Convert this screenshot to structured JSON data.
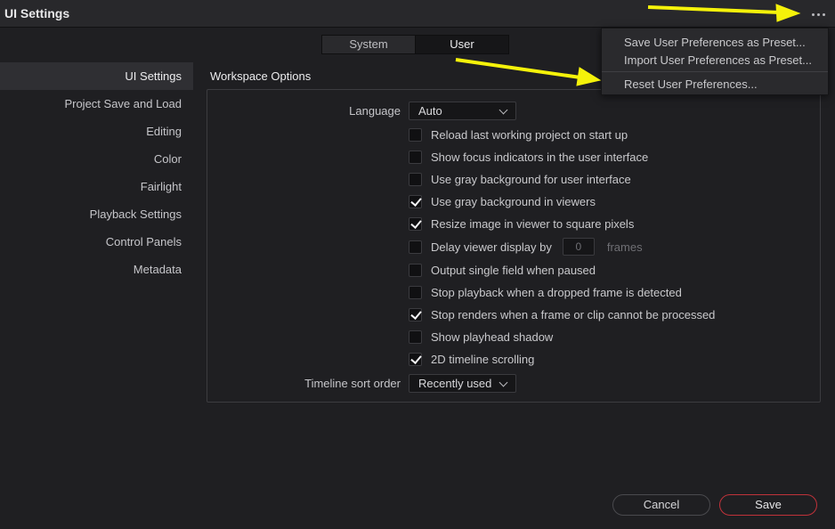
{
  "window": {
    "title": "UI Settings"
  },
  "tabs": [
    {
      "label": "System"
    },
    {
      "label": "User"
    }
  ],
  "sidebar": {
    "items": [
      {
        "label": "UI Settings"
      },
      {
        "label": "Project Save and Load"
      },
      {
        "label": "Editing"
      },
      {
        "label": "Color"
      },
      {
        "label": "Fairlight"
      },
      {
        "label": "Playback Settings"
      },
      {
        "label": "Control Panels"
      },
      {
        "label": "Metadata"
      }
    ]
  },
  "workspace": {
    "title": "Workspace Options",
    "language_label": "Language",
    "language_value": "Auto",
    "options": [
      {
        "label": "Reload last working project on start up",
        "checked": false
      },
      {
        "label": "Show focus indicators in the user interface",
        "checked": false
      },
      {
        "label": "Use gray background for user interface",
        "checked": false
      },
      {
        "label": "Use gray background in viewers",
        "checked": true
      },
      {
        "label": "Resize image in viewer to square pixels",
        "checked": true
      },
      {
        "label": "Delay viewer display by",
        "checked": false
      },
      {
        "label": "Output single field when paused",
        "checked": false
      },
      {
        "label": "Stop playback when a dropped frame is detected",
        "checked": false
      },
      {
        "label": "Stop renders when a frame or clip cannot be processed",
        "checked": true
      },
      {
        "label": "Show playhead shadow",
        "checked": false
      },
      {
        "label": "2D timeline scrolling",
        "checked": true
      }
    ],
    "delay_frames_value": "0",
    "delay_frames_suffix": "frames",
    "sort_label": "Timeline sort order",
    "sort_value": "Recently used"
  },
  "menu": {
    "items": [
      {
        "label": "Save User Preferences as Preset..."
      },
      {
        "label": "Import User Preferences as Preset..."
      },
      {
        "label": "Reset User Preferences..."
      }
    ]
  },
  "footer": {
    "cancel_label": "Cancel",
    "save_label": "Save"
  },
  "colors": {
    "accent_red": "#c0323a",
    "annotation_yellow": "#f5f20a",
    "background": "#1f1f22"
  },
  "icons": [
    "more-options-icon",
    "chevron-down-icon",
    "checkmark-icon",
    "annotation-arrow"
  ]
}
